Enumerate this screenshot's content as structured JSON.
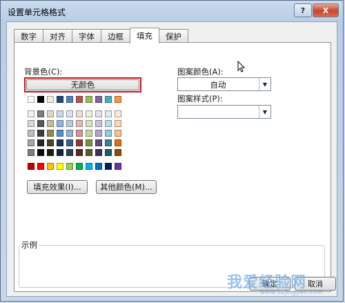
{
  "window": {
    "title": "设置单元格格式",
    "help_label": "?",
    "close_label": "X"
  },
  "tabs": [
    {
      "label": "数字"
    },
    {
      "label": "对齐"
    },
    {
      "label": "字体"
    },
    {
      "label": "边框"
    },
    {
      "label": "填充"
    },
    {
      "label": "保护"
    }
  ],
  "active_tab": "填充",
  "fill": {
    "background_label": "背景色(C):",
    "no_color_label": "无颜色",
    "palette_top": [
      "#ffffff",
      "#000000",
      "#eeece1",
      "#1f497d",
      "#4f81bd",
      "#c0504d",
      "#9bbb59",
      "#8064a2",
      "#4bacc6",
      "#f79646"
    ],
    "palette_theme": [
      [
        "#f2f2f2",
        "#7f7f7f",
        "#ddd9c3",
        "#c6d9f0",
        "#dbe5f1",
        "#f2dcdb",
        "#ebf1dd",
        "#e5e0ec",
        "#dbeef3",
        "#fdeada"
      ],
      [
        "#d8d8d8",
        "#595959",
        "#c4bd97",
        "#8db3e2",
        "#b8cce4",
        "#e5b9b7",
        "#d7e3bc",
        "#ccc1d9",
        "#b7dde8",
        "#fbd5b5"
      ],
      [
        "#bfbfbf",
        "#3f3f3f",
        "#938953",
        "#548dd4",
        "#95b3d7",
        "#d99694",
        "#c3d69b",
        "#b2a2c7",
        "#92cddc",
        "#fac08f"
      ],
      [
        "#a5a5a5",
        "#262626",
        "#494429",
        "#17365d",
        "#366092",
        "#953734",
        "#76923c",
        "#5f497a",
        "#31859b",
        "#e36c09"
      ],
      [
        "#7f7f7f",
        "#0c0c0c",
        "#1d1b10",
        "#0f243e",
        "#244061",
        "#632423",
        "#4f6128",
        "#3f3151",
        "#205867",
        "#974806"
      ]
    ],
    "palette_standard": [
      "#c00000",
      "#ff0000",
      "#ffc000",
      "#ffff00",
      "#92d050",
      "#00b050",
      "#00b0f0",
      "#0070c0",
      "#002060",
      "#7030a0"
    ],
    "fill_effects_label": "填充效果(I)...",
    "more_colors_label": "其他颜色(M)...",
    "pattern_color_label": "图案颜色(A):",
    "pattern_color_value": "自动",
    "pattern_style_label": "图案样式(P):",
    "pattern_style_value": "",
    "sample_label": "示例"
  },
  "footer": {
    "ok_label": "确定",
    "cancel_label": "取消"
  },
  "watermark": {
    "text": "我爱经验网",
    "sub": "www.52jingyan.com"
  }
}
